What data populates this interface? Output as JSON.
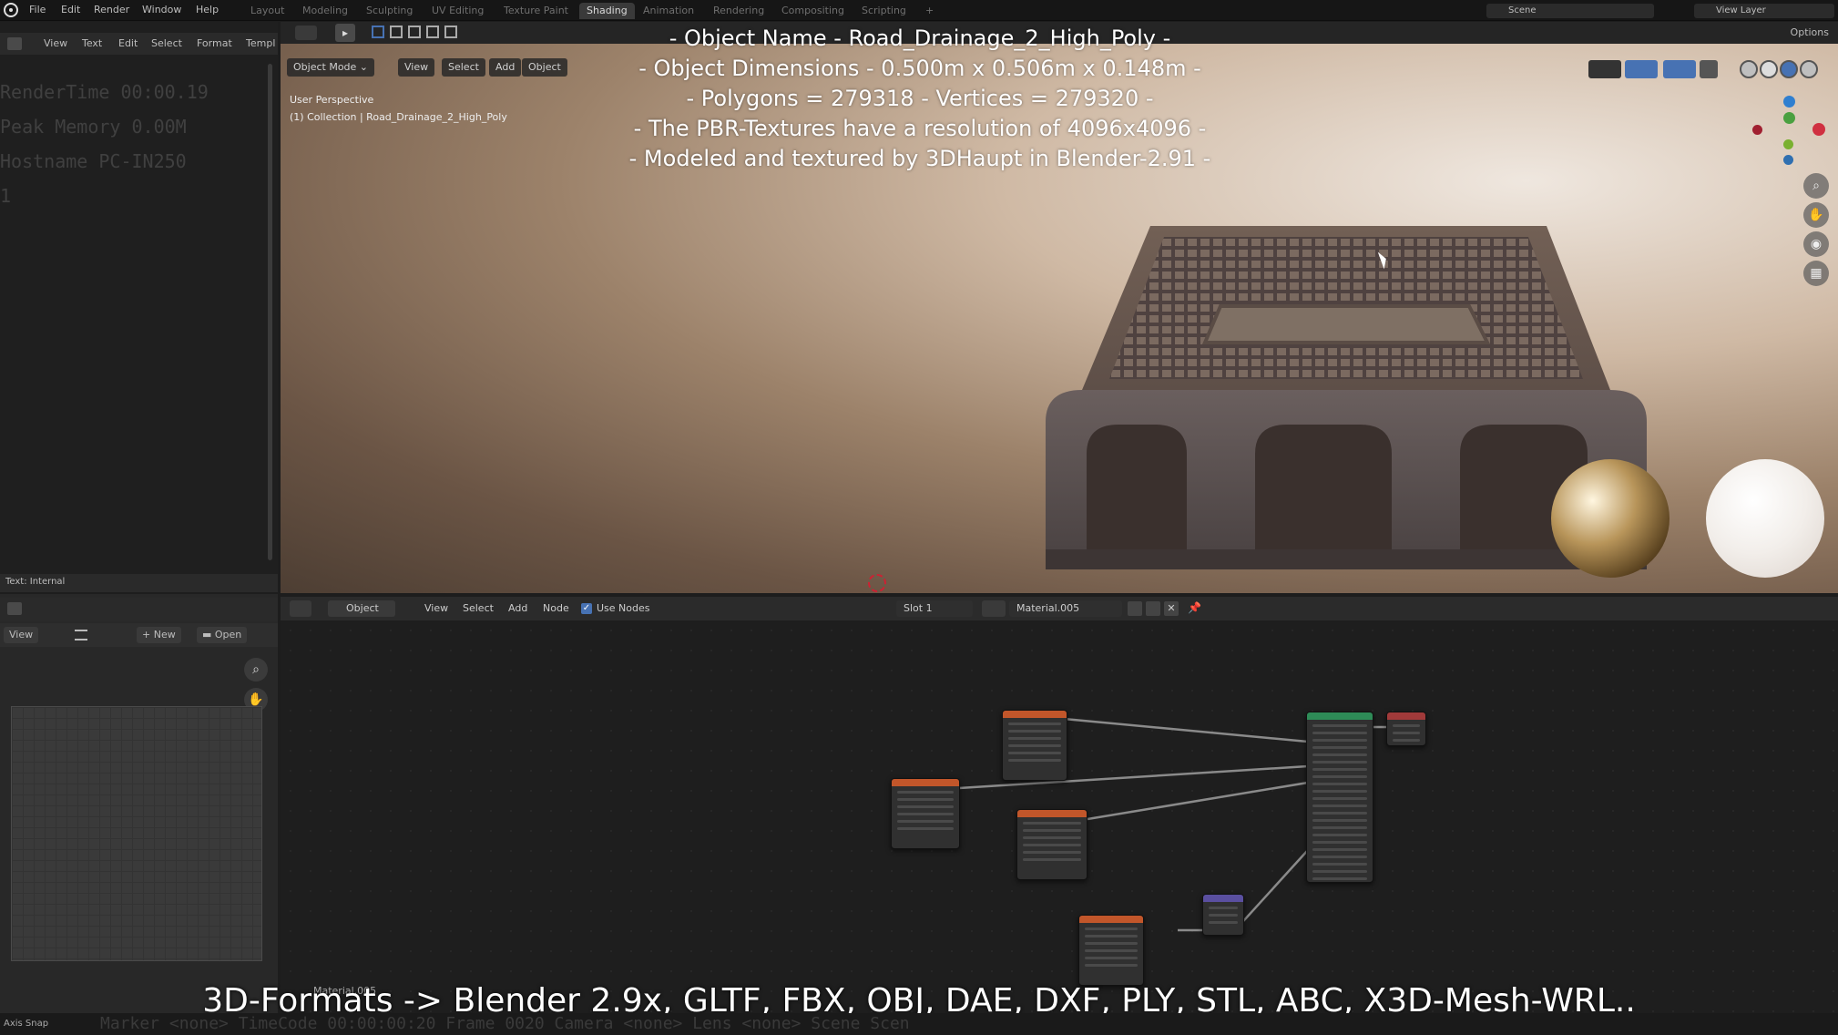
{
  "topbar": {
    "menus": [
      "File",
      "Edit",
      "Render",
      "Window",
      "Help"
    ],
    "workspaces": [
      "Layout",
      "Modeling",
      "Sculpting",
      "UV Editing",
      "Texture Paint",
      "Shading",
      "Animation",
      "Rendering",
      "Compositing",
      "Scripting"
    ],
    "active_workspace": "Shading",
    "add_tab": "+",
    "scene": "Scene",
    "view_layer": "View Layer",
    "options": "Options"
  },
  "text_editor": {
    "header_items": [
      "View",
      "Text",
      "Edit",
      "Select",
      "Format",
      "Templ"
    ],
    "lines": [
      "RenderTime 00:00.19",
      "Peak Memory 0.00M",
      "Hostname PC-IN250",
      "1"
    ],
    "footer": "Text: Internal"
  },
  "image_editor": {
    "view": "View",
    "new": "New",
    "open": "Open"
  },
  "viewport": {
    "mode": "Object Mode",
    "menus": [
      "View",
      "Select",
      "Add",
      "Object"
    ],
    "perspective": "User Perspective",
    "collection": "(1) Collection | Road_Drainage_2_High_Poly"
  },
  "overlay": {
    "lines": [
      "- Object Name - Road_Drainage_2_High_Poly -",
      "- Object Dimensions -  0.500m x 0.506m x 0.148m -",
      "- Polygons = 279318  -  Vertices = 279320 -",
      "- The PBR-Textures have a resolution of 4096x4096 -",
      "- Modeled and textured by 3DHaupt in Blender-2.91 -"
    ]
  },
  "node_editor": {
    "object": "Object",
    "menus": [
      "View",
      "Select",
      "Add",
      "Node"
    ],
    "use_nodes": "Use Nodes",
    "slot": "Slot 1",
    "material": "Material.005",
    "bottom_label": "Material.005"
  },
  "caption": "3D-Formats -> Blender 2.9x, GLTF, FBX, OBJ, DAE, DXF, PLY, STL, ABC, X3D-Mesh-WRL..",
  "status_bar": {
    "axis_snap": "Axis Snap",
    "text": "Marker <none>   TimeCode 00:00:00:20   Frame 0020   Camera <none>   Lens <none>              Scene Scen"
  },
  "colors": {
    "accent_blue": "#4772b3",
    "header_orange": "#c2562a",
    "header_green": "#2e8b57",
    "header_red": "#a13a3a",
    "header_purple": "#5a4fa0"
  }
}
